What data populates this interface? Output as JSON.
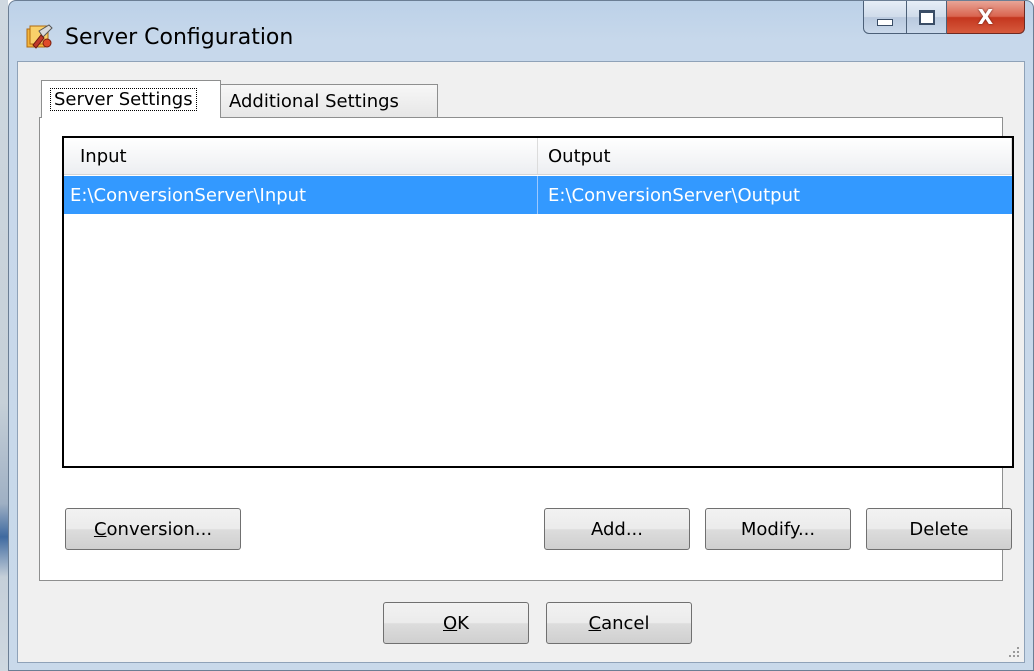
{
  "window": {
    "title": "Server Configuration",
    "close_glyph": "X"
  },
  "tabs": [
    {
      "label": "Server Settings",
      "active": true
    },
    {
      "label": "Additional Settings",
      "active": false
    }
  ],
  "listview": {
    "columns": [
      "Input",
      "Output"
    ],
    "rows": [
      {
        "input": "E:\\ConversionServer\\Input",
        "output": "E:\\ConversionServer\\Output",
        "selected": true
      }
    ]
  },
  "buttons": {
    "conversion": {
      "mnemonic": "C",
      "rest": "onversion..."
    },
    "add": "Add...",
    "modify": "Modify...",
    "delete": "Delete",
    "ok": {
      "mnemonic": "O",
      "rest": "K"
    },
    "cancel": {
      "mnemonic": "C",
      "rest": "ancel"
    }
  },
  "colors": {
    "selection": "#3399ff",
    "client_bg": "#f0f0f0",
    "frame": "#c9d9ea"
  },
  "icons": [
    "app-config-icon",
    "minimize-icon",
    "maximize-icon",
    "close-icon",
    "size-grip-icon"
  ]
}
